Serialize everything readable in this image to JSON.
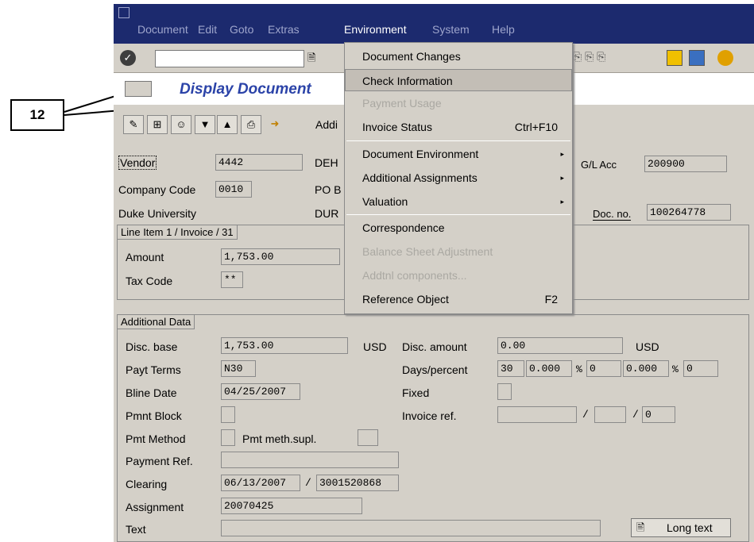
{
  "callout": {
    "number": "12"
  },
  "menubar": {
    "items": [
      "Document",
      "Edit",
      "Goto",
      "Extras",
      "Environment",
      "System",
      "Help"
    ]
  },
  "title": "Display Document",
  "toolbar2": {
    "add_label": "Addi"
  },
  "header": {
    "vendor_label": "Vendor",
    "vendor_value": "4442",
    "vendor_name": "DEH",
    "company_code_label": "Company Code",
    "company_code_value": "0010",
    "company_line": "Duke University",
    "po_box": "PO B",
    "dur": "DUR",
    "gl_acc_label": "G/L Acc",
    "gl_acc_value": "200900",
    "doc_no_label": "Doc. no.",
    "doc_no_value": "100264778"
  },
  "line_item": {
    "group_title": "Line Item 1 / Invoice / 31",
    "amount_label": "Amount",
    "amount_value": "1,753.00",
    "tax_code_label": "Tax Code",
    "tax_code_value": "**"
  },
  "additional": {
    "group_title": "Additional Data",
    "disc_base_label": "Disc. base",
    "disc_base_value": "1,753.00",
    "disc_base_currency": "USD",
    "disc_amount_label": "Disc. amount",
    "disc_amount_value": "0.00",
    "disc_amount_currency": "USD",
    "payt_terms_label": "Payt Terms",
    "payt_terms_value": "N30",
    "days_percent_label": "Days/percent",
    "days1": "30",
    "pct1": "0.000",
    "pct_sym1": "%",
    "days2": "0",
    "pct2": "0.000",
    "pct_sym2": "%",
    "days3": "0",
    "bline_date_label": "Bline Date",
    "bline_date_value": "04/25/2007",
    "fixed_label": "Fixed",
    "pmnt_block_label": "Pmnt Block",
    "invoice_ref_label": "Invoice ref.",
    "invoice_ref_sep1": "/",
    "invoice_ref_sep2": "/",
    "invoice_ref_value": "0",
    "pmt_method_label": "Pmt Method",
    "pmt_meth_supl_label": "Pmt meth.supl.",
    "payment_ref_label": "Payment Ref.",
    "clearing_label": "Clearing",
    "clearing_value": "06/13/2007",
    "clearing_sep": "/",
    "clearing_doc": "3001520868",
    "assignment_label": "Assignment",
    "assignment_value": "20070425",
    "text_label": "Text",
    "long_text_label": "Long text"
  },
  "dropdown": {
    "items": [
      {
        "label": "Document Changes",
        "shortcut": "",
        "submenu": false,
        "disabled": false
      },
      {
        "label": "Check Information",
        "shortcut": "",
        "submenu": false,
        "disabled": false,
        "selected": true
      },
      {
        "label": "Payment Usage",
        "shortcut": "",
        "submenu": false,
        "disabled": true
      },
      {
        "label": "Invoice Status",
        "shortcut": "Ctrl+F10",
        "submenu": false,
        "disabled": false
      },
      {
        "label": "Document Environment",
        "shortcut": "",
        "submenu": true,
        "disabled": false
      },
      {
        "label": "Additional Assignments",
        "shortcut": "",
        "submenu": true,
        "disabled": false
      },
      {
        "label": "Valuation",
        "shortcut": "",
        "submenu": true,
        "disabled": false
      },
      {
        "label": "Correspondence",
        "shortcut": "",
        "submenu": false,
        "disabled": false
      },
      {
        "label": "Balance Sheet Adjustment",
        "shortcut": "",
        "submenu": false,
        "disabled": true
      },
      {
        "label": "Addtnl components...",
        "shortcut": "",
        "submenu": false,
        "disabled": true
      },
      {
        "label": "Reference Object",
        "shortcut": "F2",
        "submenu": false,
        "disabled": false
      }
    ]
  }
}
